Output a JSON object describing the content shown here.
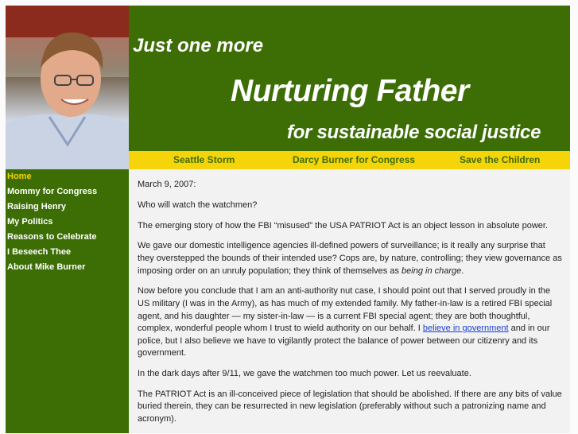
{
  "header": {
    "line1": "Just one more",
    "line2": "Nurturing Father",
    "line3": "for sustainable social justice"
  },
  "topnav": [
    "Seattle Storm",
    "Darcy Burner for Congress",
    "Save the Children"
  ],
  "sidebar": [
    "Home",
    "Mommy for Congress",
    "Raising Henry",
    "My Politics",
    "Reasons to Celebrate",
    "I Beseech Thee",
    "About Mike Burner"
  ],
  "article": {
    "date": "March 9, 2007:",
    "p1": "Who will watch the watchmen?",
    "p2": "The emerging story of how the FBI “misused” the USA PATRIOT Act is an object lesson in absolute power.",
    "p3a": "We gave our domestic intelligence agencies ill-defined powers of surveillance; is it really any surprise that they overstepped the bounds of their intended use?  Cops are, by nature, controlling; they view governance as imposing order on an unruly population; they think of themselves as ",
    "p3em": "being in charge",
    "p3b": ".",
    "p4a": "Now before you conclude that I am an anti-authority nut case, I should point out that I served proudly in the US military (I was in the Army), as has much of my extended family.  My father-in-law is a retired FBI special agent, and his daughter — my sister-in-law — is a current FBI special agent; they are both thoughtful, complex, wonderful people whom I trust to wield authority on our behalf.  I ",
    "p4link": "believe in government",
    "p4b": " and in our police, but I also believe we have to vigilantly protect the balance of power between our citizenry and its government.",
    "p5": "In the dark days after 9/11, we gave the watchmen too much power.  Let us reevaluate.",
    "p6": "The PATRIOT Act is an ill-conceived piece of legislation that should be abolished.  If there are any bits of value buried therein, they can be resurrected in new legislation (preferably without such a patronizing name and acronym)."
  },
  "colors": {
    "green": "#3c6e05",
    "yellow": "#f5d40a",
    "link": "#1a3fd0"
  }
}
